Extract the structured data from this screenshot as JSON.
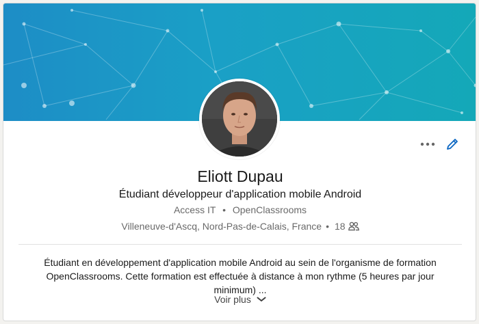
{
  "profile": {
    "name": "Eliott Dupau",
    "headline": "Étudiant développeur d'application mobile Android",
    "companies": [
      "Access IT",
      "OpenClassrooms"
    ],
    "separator": "•",
    "location": "Villeneuve-d'Ascq, Nord-Pas-de-Calais, France",
    "connections": "18"
  },
  "summary": {
    "line1": "Étudiant en développement d'application mobile Android au sein de l'organisme de formation",
    "line2": "OpenClassrooms. Cette formation est effectuée à distance à mon rythme (5 heures par jour minimum) ...",
    "see_more_label": "Voir plus"
  },
  "icons": {
    "more": "more-icon",
    "edit": "pencil-icon",
    "connections": "people-icon",
    "chevron": "chevron-down-icon"
  },
  "colors": {
    "accent": "#0a66c2",
    "banner_left": "#1d8dc6",
    "banner_right": "#14a8b8"
  }
}
